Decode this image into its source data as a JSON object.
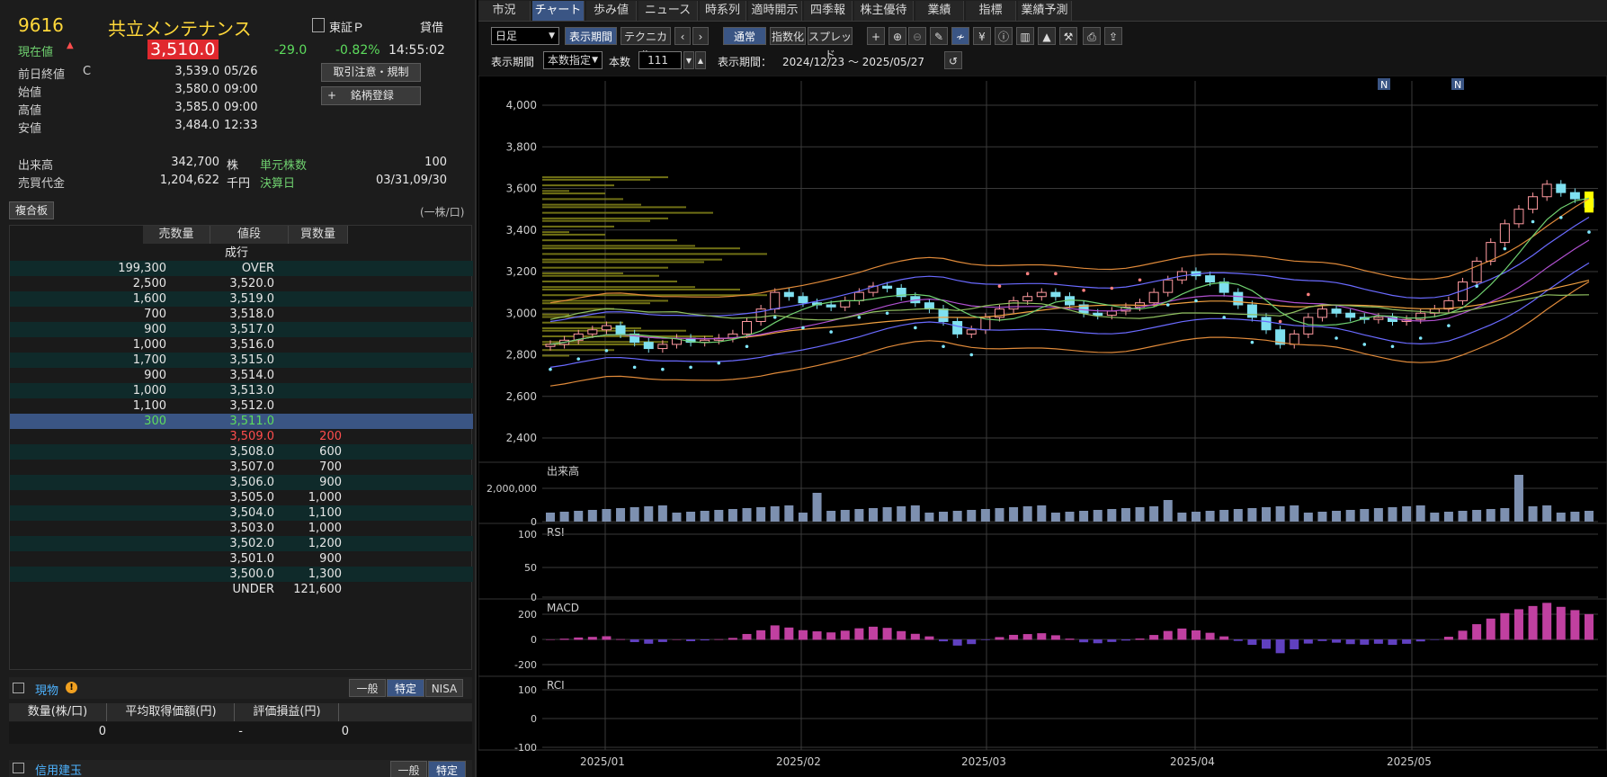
{
  "stock": {
    "code": "9616",
    "name": "共立メンテナンス",
    "exchange": "東証Ｐ",
    "margin_type": "貸借",
    "current_label": "現在値",
    "current_price": "3,510.0",
    "change": "-29.0",
    "change_pct": "-0.82%",
    "time": "14:55:02",
    "prev_close_label": "前日終値",
    "prev_close_flag": "C",
    "prev_close": "3,539.0",
    "prev_close_date": "05/26",
    "open_label": "始値",
    "open": "3,580.0",
    "open_time": "09:00",
    "high_label": "高値",
    "high": "3,585.0",
    "high_time": "09:00",
    "low_label": "安値",
    "low": "3,484.0",
    "low_time": "12:33",
    "volume_label": "出来高",
    "volume": "342,700",
    "volume_unit": "株",
    "unit_label": "単元株数",
    "unit": "100",
    "turnover_label": "売買代金",
    "turnover": "1,204,622",
    "turnover_unit": "千円",
    "settle_label": "決算日",
    "settle": "03/31,09/30",
    "btn_notice": "取引注意・規制",
    "btn_register": "銘柄登録",
    "btn_register_plus": "+",
    "board_btn": "複合板",
    "board_unit": "(一株/口)"
  },
  "board": {
    "headers": [
      "売数量",
      "値段",
      "買数量"
    ],
    "rows": [
      {
        "sell": "",
        "price": "成行",
        "buy": ""
      },
      {
        "sell": "199,300",
        "price": "OVER",
        "buy": ""
      },
      {
        "sell": "2,500",
        "price": "3,520.0",
        "buy": ""
      },
      {
        "sell": "1,600",
        "price": "3,519.0",
        "buy": ""
      },
      {
        "sell": "700",
        "price": "3,518.0",
        "buy": ""
      },
      {
        "sell": "900",
        "price": "3,517.0",
        "buy": ""
      },
      {
        "sell": "1,000",
        "price": "3,516.0",
        "buy": ""
      },
      {
        "sell": "1,700",
        "price": "3,515.0",
        "buy": ""
      },
      {
        "sell": "900",
        "price": "3,514.0",
        "buy": ""
      },
      {
        "sell": "1,000",
        "price": "3,513.0",
        "buy": ""
      },
      {
        "sell": "1,100",
        "price": "3,512.0",
        "buy": ""
      },
      {
        "sell": "300",
        "price": "3,511.0",
        "buy": ""
      },
      {
        "sell": "",
        "price": "3,509.0",
        "buy": "200"
      },
      {
        "sell": "",
        "price": "3,508.0",
        "buy": "600"
      },
      {
        "sell": "",
        "price": "3,507.0",
        "buy": "700"
      },
      {
        "sell": "",
        "price": "3,506.0",
        "buy": "900"
      },
      {
        "sell": "",
        "price": "3,505.0",
        "buy": "1,000"
      },
      {
        "sell": "",
        "price": "3,504.0",
        "buy": "1,100"
      },
      {
        "sell": "",
        "price": "3,503.0",
        "buy": "1,000"
      },
      {
        "sell": "",
        "price": "3,502.0",
        "buy": "1,200"
      },
      {
        "sell": "",
        "price": "3,501.0",
        "buy": "900"
      },
      {
        "sell": "",
        "price": "3,500.0",
        "buy": "1,300"
      },
      {
        "sell": "",
        "price": "UNDER",
        "buy": "121,600"
      }
    ]
  },
  "holdings": {
    "title": "現物",
    "tabs": [
      "一般",
      "特定",
      "NISA"
    ],
    "headers": [
      "数量(株/口)",
      "平均取得価額(円)",
      "評価損益(円)"
    ],
    "values": [
      "0",
      "-",
      "0"
    ],
    "margin_title": "信用建玉",
    "margin_tabs": [
      "一般",
      "特定"
    ]
  },
  "right": {
    "tabs": [
      "市況",
      "チャート",
      "歩み値",
      "ニュース",
      "時系列",
      "適時開示",
      "四季報",
      "株主優待",
      "業績",
      "指標",
      "業績予測"
    ],
    "period_select": "日足",
    "btn_display_period": "表示期間",
    "btn_technical": "テクニカル",
    "btn_normal": "通常",
    "btn_index": "指数化",
    "btn_spread": "スプレッド",
    "period_label": "表示期間",
    "period_mode": "本数指定",
    "count_label": "本数",
    "count": "111",
    "range_label": "表示期間：",
    "range": "2024/12/23 ～ 2025/05/27",
    "news_badge": "N"
  },
  "chart_data": [
    {
      "type": "candlestick",
      "yticks": [
        "4,000",
        "3,800",
        "3,600",
        "3,400",
        "3,200",
        "3,000",
        "2,800",
        "2,600",
        "2,400"
      ],
      "ylim": [
        2400,
        4000
      ],
      "xticks": [
        "2025/01",
        "2025/02",
        "2025/03",
        "2025/04",
        "2025/05"
      ],
      "close_path": [
        2850,
        2870,
        2900,
        2920,
        2940,
        2900,
        2860,
        2830,
        2850,
        2880,
        2860,
        2870,
        2880,
        2900,
        2960,
        3020,
        3100,
        3080,
        3050,
        3040,
        3030,
        3060,
        3100,
        3130,
        3120,
        3080,
        3050,
        3020,
        2960,
        2900,
        2920,
        2980,
        3020,
        3060,
        3080,
        3100,
        3080,
        3040,
        3000,
        2990,
        3010,
        3030,
        3050,
        3100,
        3160,
        3200,
        3180,
        3150,
        3100,
        3040,
        2980,
        2920,
        2850,
        2900,
        2980,
        3020,
        3000,
        2980,
        2970,
        2980,
        2960,
        2970,
        3000,
        3020,
        3060,
        3150,
        3250,
        3340,
        3430,
        3500,
        3560,
        3620,
        3580,
        3550,
        3510
      ]
    },
    {
      "type": "bar",
      "title": "出来高",
      "yticks": [
        "2,000,000",
        "0"
      ]
    },
    {
      "type": "line",
      "title": "RSI",
      "yticks": [
        "100",
        "50",
        "0"
      ]
    },
    {
      "type": "line",
      "title": "MACD",
      "yticks": [
        "200",
        "0",
        "-200"
      ]
    },
    {
      "type": "line",
      "title": "RCI",
      "yticks": [
        "100",
        "0",
        "-100"
      ]
    }
  ]
}
